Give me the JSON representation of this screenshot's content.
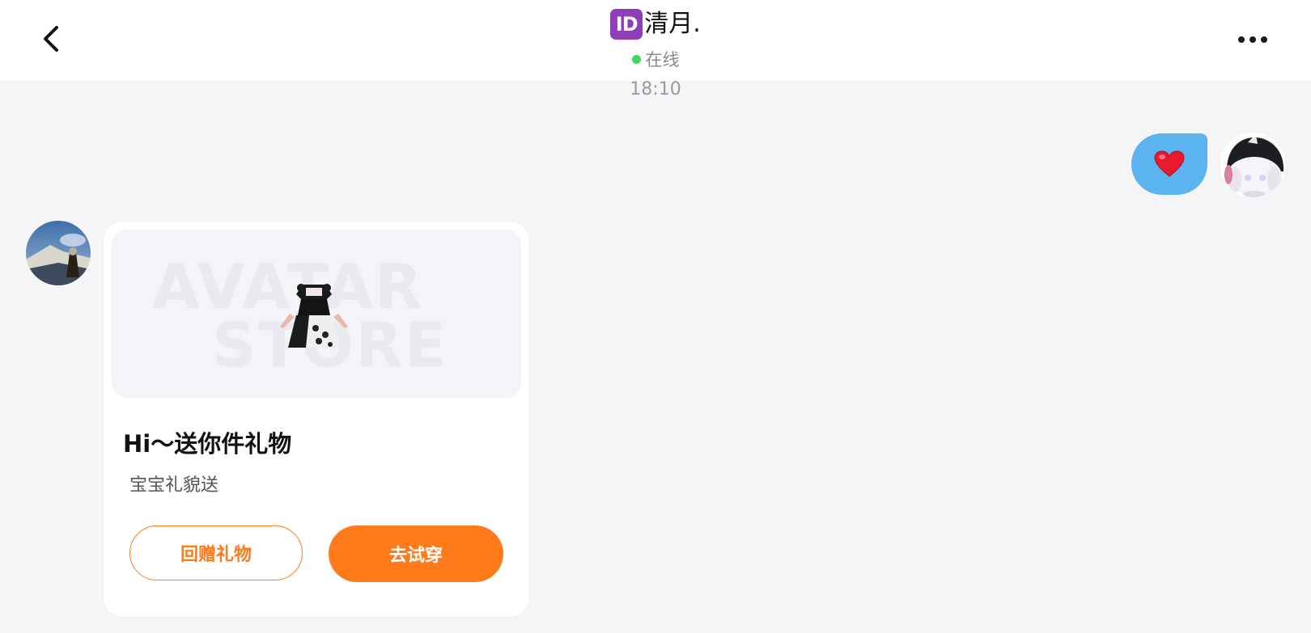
{
  "header": {
    "badge": "ID",
    "contact_name": "清月.",
    "status": "在线"
  },
  "chat": {
    "timestamp": "18:10",
    "outgoing_message": "❤️"
  },
  "gift_card": {
    "banner_text_line1": "AVATAR",
    "banner_text_line2": "STORE",
    "title": "Hi～送你件礼物",
    "subtitle": "宝宝礼貌送",
    "return_gift_label": "回赠礼物",
    "try_on_label": "去试穿"
  },
  "colors": {
    "accent": "#ff7a1a",
    "bubble": "#5bb4f0",
    "online": "#3bd85a",
    "badge": "#8e3fb8"
  }
}
